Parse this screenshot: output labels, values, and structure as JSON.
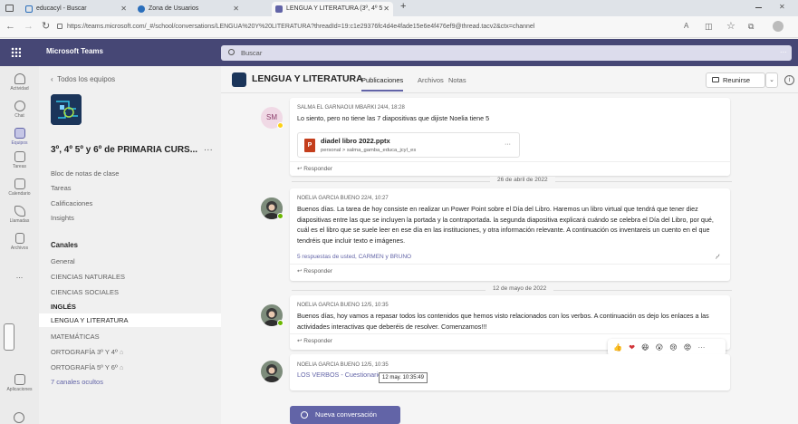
{
  "browser": {
    "tabs": [
      {
        "label": "educacyl - Buscar"
      },
      {
        "label": "Zona de Usuarios"
      },
      {
        "label": "LENGUA Y LITERATURA (3º, 4º 5"
      }
    ],
    "new_tab_symbol": "+",
    "url": "https://teams.microsoft.com/_#/school/conversations/LENGUA%20Y%20LITERATURA?threadId=19:c1e29376fc4d4e4fade15e6e4f476ef9@thread.tacv2&ctx=channel"
  },
  "teams": {
    "brand": "Microsoft Teams",
    "search_placeholder": "Buscar",
    "more": "..."
  },
  "rail": [
    {
      "label": "Actividad",
      "icon": "bell-icon"
    },
    {
      "label": "Chat",
      "icon": "chat-icon"
    },
    {
      "label": "Equipos",
      "icon": "teams-icon",
      "active": true
    },
    {
      "label": "Tareas",
      "icon": "assignments-icon"
    },
    {
      "label": "Calendario",
      "icon": "calendar-icon"
    },
    {
      "label": "Llamadas",
      "icon": "phone-icon"
    },
    {
      "label": "Archivos",
      "icon": "files-icon"
    },
    {
      "label": "...",
      "icon": "more-icon"
    },
    {
      "label": "Aplicaciones",
      "icon": "apps-icon"
    }
  ],
  "panel": {
    "back": "Todos los equipos",
    "team_name": "3º, 4º 5º y 6º de PRIMARIA CURS...",
    "team_more": "···",
    "items": [
      "Bloc de notas de clase",
      "Tareas",
      "Calificaciones",
      "Insights"
    ],
    "channels_header": "Canales",
    "channels": [
      {
        "label": "General",
        "bold": false
      },
      {
        "label": "CIENCIAS NATURALES",
        "bold": false
      },
      {
        "label": "CIENCIAS SOCIALES",
        "bold": false
      },
      {
        "label": "INGLÉS",
        "bold": true
      },
      {
        "label": "LENGUA Y LITERATURA",
        "bold": false,
        "selected": true
      },
      {
        "label": "MATEMÁTICAS",
        "bold": false
      },
      {
        "label": "ORTOGRAFÍA 3º Y 4º",
        "bold": false
      },
      {
        "label": "ORTOGRAFÍA 5º Y 6º",
        "bold": false
      }
    ],
    "hidden_channels": "7 canales ocultos"
  },
  "channel": {
    "title": "LENGUA Y LITERATURA",
    "tabs": [
      "Publicaciones",
      "Archivos",
      "Notas"
    ],
    "meet": "Reunirse"
  },
  "messages": [
    {
      "author": "SALMA EL GARNAOUI MBARKI  24/4, 18:28",
      "initials": "SM",
      "text": "Lo siento, pero no tiene las 7 diapositivas que dijiste Noelia tiene 5",
      "attachment": {
        "name": "diadel libro 2022.pptx",
        "path": "personal > salma_gamba_educa_jcyl_es",
        "more": "···"
      },
      "reply": "Responder"
    },
    {
      "date": "26 de abril de 2022",
      "author": "NOELIA GARCIA BUENO  22/4, 10:27",
      "text": "Buenos días. La tarea de hoy consiste en realizar un Power Point sobre el Día del Libro. Haremos un libro virtual que tendrá que tener diez diapositivas entre las que se incluyen la portada y la contraportada. la segunda diapositiva explicará cuándo se celebra el Día del Libro, por qué, cuál es el libro que se suele leer en ese día en las instituciones, y otra información relevante. A continuación os inventareis  un cuento en el que tendréis que incluir texto e imágenes.",
      "replies_info": "5 respuestas de usted, CARMEN y BRUNO",
      "reply": "Responder"
    },
    {
      "date": "12 de mayo de 2022",
      "author": "NOELIA GARCIA BUENO  12/5, 10:35",
      "text": "Buenos días, hoy vamos a repasar todos los contenidos que hemos visto relacionados con los verbos. A continuación os dejo los enlaces a las actividades interactivas que deberéis de resolver. Comenzamos!!!",
      "reply": "Responder"
    },
    {
      "author": "NOELIA GARCIA BUENO  12/5, 10:35",
      "link": "LOS VERBOS - Cuestionario",
      "tooltip": "12 may. 10:35:49"
    }
  ],
  "reactions": [
    "👍",
    "❤",
    "😆",
    "😮",
    "😢",
    "😡",
    "···"
  ],
  "new_conversation": "Nueva conversación",
  "colors": {
    "accent": "#6264a7",
    "header": "#464775",
    "attachment": "#c43e1c"
  }
}
